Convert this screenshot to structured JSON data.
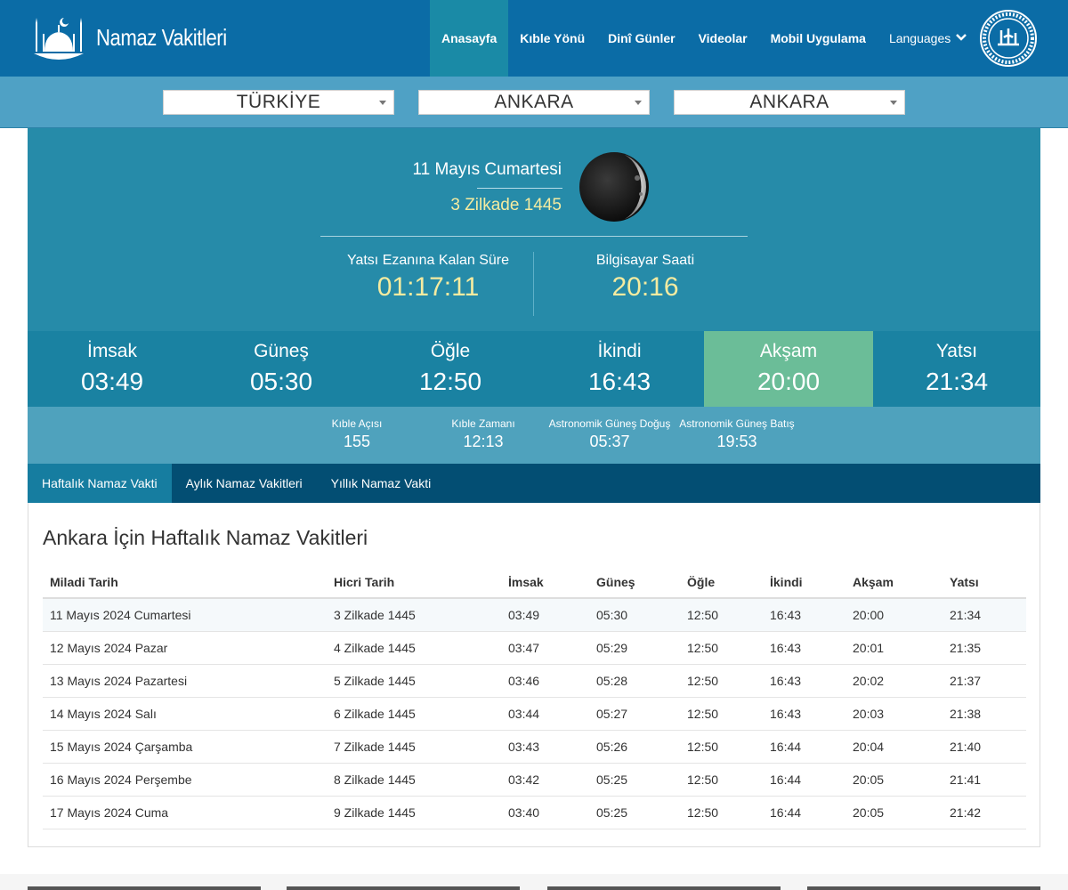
{
  "header": {
    "site_title": "Namaz Vakitleri",
    "nav": [
      {
        "label": "Anasayfa",
        "active": true
      },
      {
        "label": "Kıble Yönü"
      },
      {
        "label": "Dinî Günler"
      },
      {
        "label": "Videolar"
      },
      {
        "label": "Mobil Uygulama"
      },
      {
        "label": "Languages"
      }
    ],
    "colors": {
      "bar": "#0b6ca6",
      "active": "#1a8aa6"
    }
  },
  "location": {
    "country": "TÜRKİYE",
    "city": "ANKARA",
    "district": "ANKARA"
  },
  "hero": {
    "gregorian_date": "11 Mayıs Cumartesi",
    "hijri_date": "3 Zilkade 1445",
    "remaining_label": "Yatsı Ezanına Kalan Süre",
    "remaining_time": "01:17:11",
    "clock_label": "Bilgisayar Saati",
    "clock_time": "20:16",
    "moon_icon": "waxing-crescent-moon"
  },
  "prayers": [
    {
      "name": "İmsak",
      "time": "03:49"
    },
    {
      "name": "Güneş",
      "time": "05:30"
    },
    {
      "name": "Öğle",
      "time": "12:50"
    },
    {
      "name": "İkindi",
      "time": "16:43"
    },
    {
      "name": "Akşam",
      "time": "20:00",
      "active": true
    },
    {
      "name": "Yatsı",
      "time": "21:34"
    }
  ],
  "extra": [
    {
      "label": "Kıble Açısı",
      "value": "155"
    },
    {
      "label": "Kıble Zamanı",
      "value": "12:13"
    },
    {
      "label": "Astronomik Güneş Doğuş",
      "value": "05:37"
    },
    {
      "label": "Astronomik Güneş Batış",
      "value": "19:53"
    }
  ],
  "tabs": [
    {
      "label": "Haftalık Namaz Vakti",
      "active": true
    },
    {
      "label": "Aylık Namaz Vakitleri"
    },
    {
      "label": "Yıllık Namaz Vakti"
    }
  ],
  "weekly": {
    "title": "Ankara İçin Haftalık Namaz Vakitleri",
    "columns": [
      "Miladi Tarih",
      "Hicri Tarih",
      "İmsak",
      "Güneş",
      "Öğle",
      "İkindi",
      "Akşam",
      "Yatsı"
    ],
    "rows": [
      [
        "11 Mayıs 2024 Cumartesi",
        "3 Zilkade 1445",
        "03:49",
        "05:30",
        "12:50",
        "16:43",
        "20:00",
        "21:34"
      ],
      [
        "12 Mayıs 2024 Pazar",
        "4 Zilkade 1445",
        "03:47",
        "05:29",
        "12:50",
        "16:43",
        "20:01",
        "21:35"
      ],
      [
        "13 Mayıs 2024 Pazartesi",
        "5 Zilkade 1445",
        "03:46",
        "05:28",
        "12:50",
        "16:43",
        "20:02",
        "21:37"
      ],
      [
        "14 Mayıs 2024 Salı",
        "6 Zilkade 1445",
        "03:44",
        "05:27",
        "12:50",
        "16:43",
        "20:03",
        "21:38"
      ],
      [
        "15 Mayıs 2024 Çarşamba",
        "7 Zilkade 1445",
        "03:43",
        "05:26",
        "12:50",
        "16:44",
        "20:04",
        "21:40"
      ],
      [
        "16 Mayıs 2024 Perşembe",
        "8 Zilkade 1445",
        "03:42",
        "05:25",
        "12:50",
        "16:44",
        "20:05",
        "21:41"
      ],
      [
        "17 Mayıs 2024 Cuma",
        "9 Zilkade 1445",
        "03:40",
        "05:25",
        "12:50",
        "16:44",
        "20:05",
        "21:42"
      ]
    ]
  }
}
